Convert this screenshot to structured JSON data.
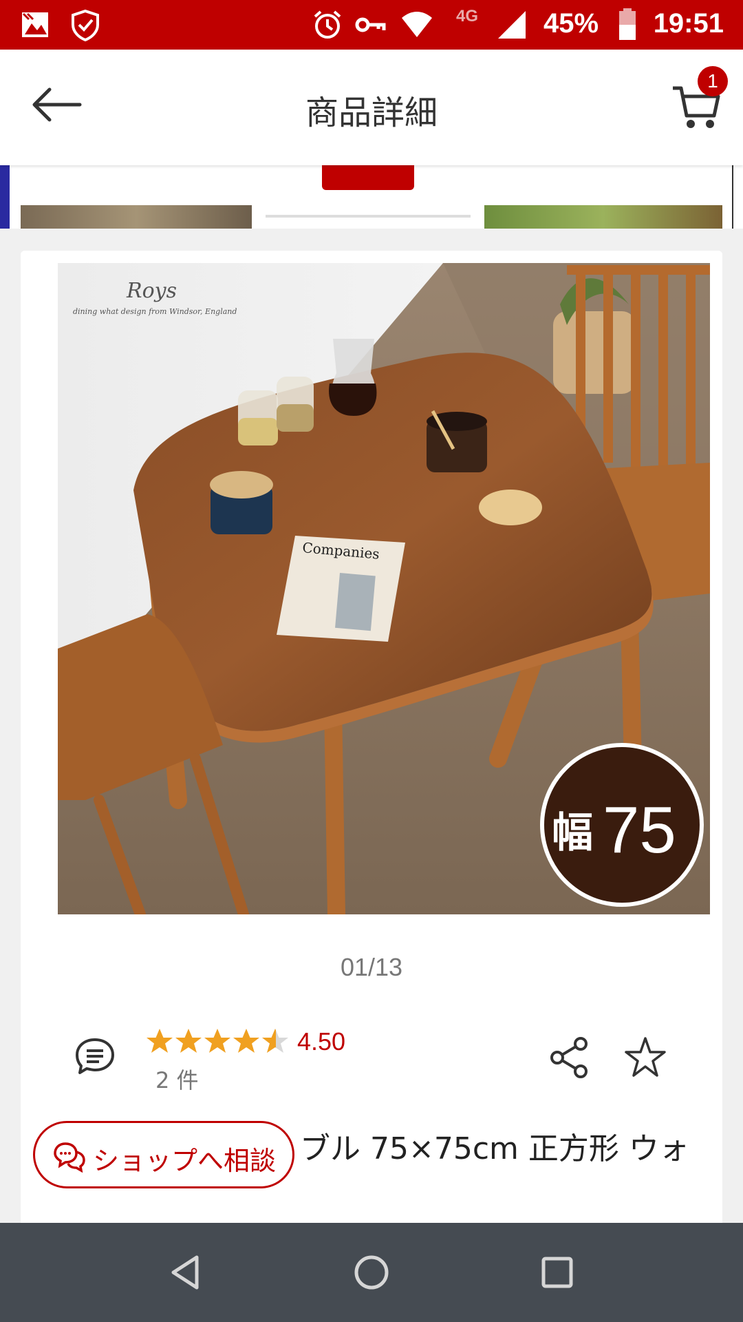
{
  "status_bar": {
    "time": "19:51",
    "battery_percent": "45%",
    "network": "4G"
  },
  "header": {
    "title": "商品詳細",
    "cart_count": "1"
  },
  "product": {
    "image_counter": "01/13",
    "image_overlay": {
      "brand": "Roys",
      "brand_tagline": "dining what design  from Windsor, England",
      "width_badge_kanji": "幅",
      "width_badge_value": "75",
      "newspaper_headline": "Companies"
    },
    "rating_value": "4.50",
    "rating_stars": 4.5,
    "review_count": "2 件",
    "title_visible": "ブル 75×75cm 正方形 ウォ"
  },
  "consult_button": {
    "label": "ショップへ相談"
  },
  "colors": {
    "brand_red": "#bf0000",
    "star": "#f0a020",
    "nav_bar": "#454b52"
  },
  "icons": [
    "back-arrow-icon",
    "cart-icon",
    "review-icon",
    "share-icon",
    "favorite-star-icon",
    "chat-icon",
    "nav-back-icon",
    "nav-home-icon",
    "nav-recents-icon"
  ]
}
